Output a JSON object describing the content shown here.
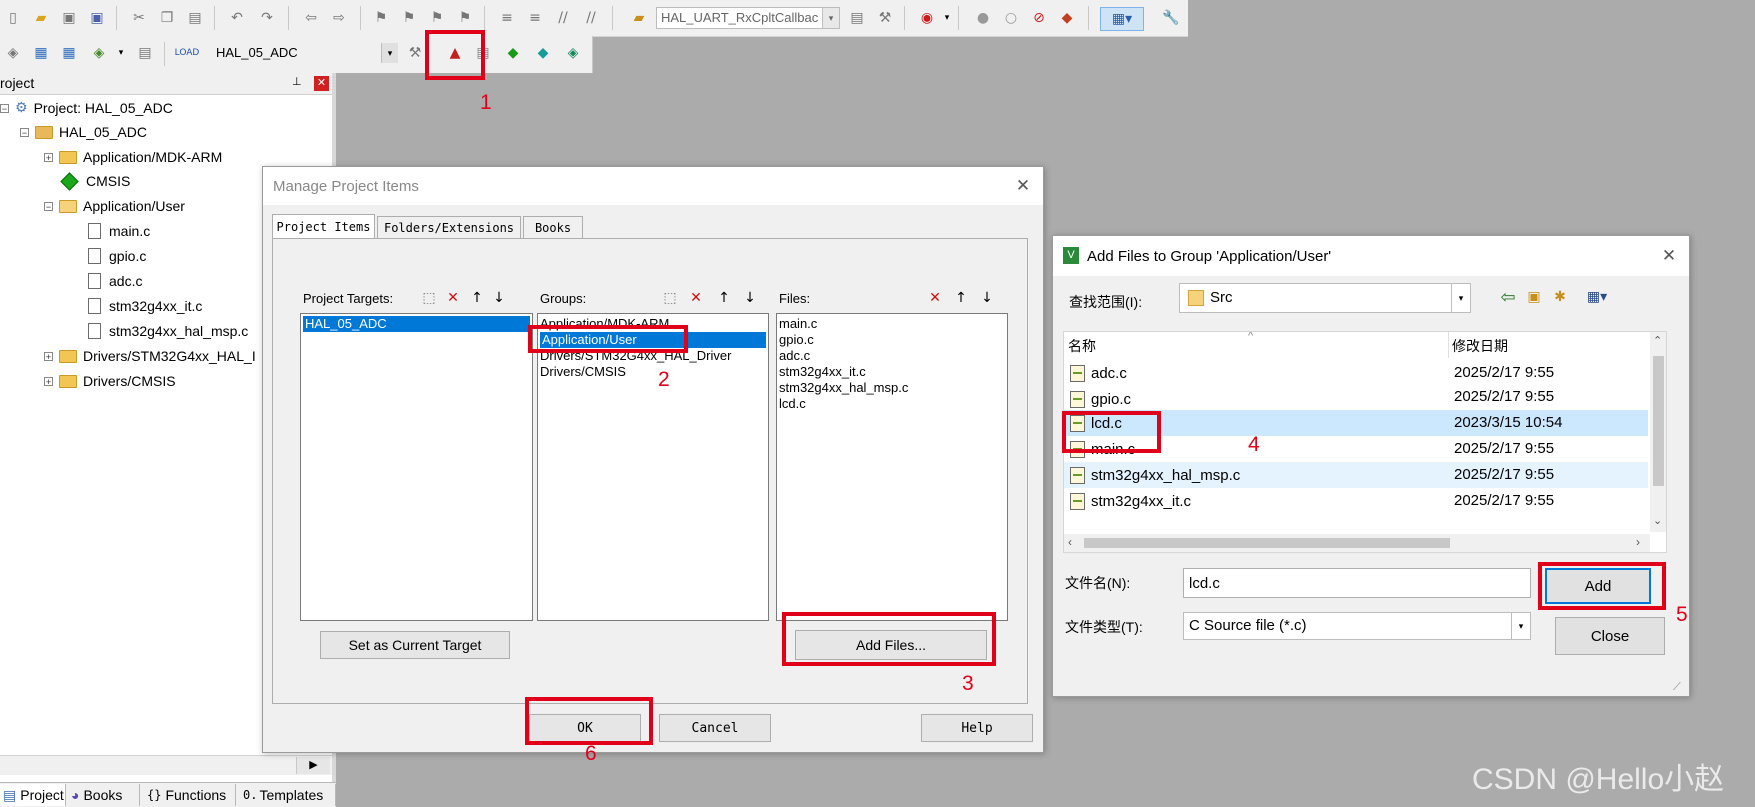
{
  "toolbar": {
    "callback_combo": "HAL_UART_RxCpltCallbac",
    "target_combo": "HAL_05_ADC"
  },
  "project_panel": {
    "title": "roject",
    "pin": "p",
    "tree": [
      {
        "label": "Project: HAL_05_ADC"
      },
      {
        "label": "HAL_05_ADC"
      },
      {
        "label": "Application/MDK-ARM"
      },
      {
        "label": "CMSIS"
      },
      {
        "label": "Application/User"
      },
      {
        "label": "main.c"
      },
      {
        "label": "gpio.c"
      },
      {
        "label": "adc.c"
      },
      {
        "label": "stm32g4xx_it.c"
      },
      {
        "label": "stm32g4xx_hal_msp.c"
      },
      {
        "label": "Drivers/STM32G4xx_HAL_I"
      },
      {
        "label": "Drivers/CMSIS"
      }
    ],
    "bottom_tabs": [
      "Project",
      "Books",
      "Functions",
      "Templates"
    ],
    "bottom_tab_icons": [
      "{}",
      "0."
    ]
  },
  "manage_dialog": {
    "title": "Manage Project Items",
    "tabs": [
      "Project Items",
      "Folders/Extensions",
      "Books"
    ],
    "targets_label": "Project Targets:",
    "groups_label": "Groups:",
    "files_label": "Files:",
    "targets": [
      "HAL_05_ADC"
    ],
    "groups": [
      "Application/MDK-ARM",
      "Application/User",
      "Drivers/STM32G4xx_HAL_Driver",
      "Drivers/CMSIS"
    ],
    "files": [
      "main.c",
      "gpio.c",
      "adc.c",
      "stm32g4xx_it.c",
      "stm32g4xx_hal_msp.c",
      "lcd.c"
    ],
    "set_target_btn": "Set as Current Target",
    "add_files_btn": "Add Files...",
    "ok_btn": "OK",
    "cancel_btn": "Cancel",
    "help_btn": "Help"
  },
  "add_dialog": {
    "title": "Add Files to Group 'Application/User'",
    "look_in_label": "查找范围(I):",
    "look_in_value": "Src",
    "col_name": "名称",
    "col_date": "修改日期",
    "files": [
      {
        "name": "adc.c",
        "date": "2025/2/17 9:55"
      },
      {
        "name": "gpio.c",
        "date": "2025/2/17 9:55"
      },
      {
        "name": "lcd.c",
        "date": "2023/3/15 10:54"
      },
      {
        "name": "main.c",
        "date": "2025/2/17 9:55"
      },
      {
        "name": "stm32g4xx_hal_msp.c",
        "date": "2025/2/17 9:55"
      },
      {
        "name": "stm32g4xx_it.c",
        "date": "2025/2/17 9:55"
      }
    ],
    "filename_label": "文件名(N):",
    "filename_value": "lcd.c",
    "filetype_label": "文件类型(T):",
    "filetype_value": "C Source file (*.c)",
    "add_btn": "Add",
    "close_btn": "Close"
  },
  "annotations": [
    "1",
    "2",
    "3",
    "4",
    "5",
    "6"
  ],
  "watermark": "CSDN @Hello小赵",
  "colors": {
    "highlight": "#0078d7",
    "annotation": "#e0001a",
    "selected_row": "#cce8ff"
  }
}
